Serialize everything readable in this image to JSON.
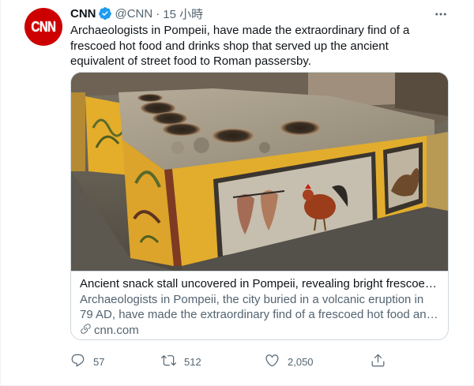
{
  "tweet": {
    "author_name": "CNN",
    "avatar_text": "CNN",
    "handle": "@CNN",
    "separator": "·",
    "time": "15 小時",
    "text": "Archaeologists in Pompeii, have made the extraordinary find of a frescoed hot food and drinks shop that served up the ancient equivalent of street food to Roman passersby."
  },
  "card": {
    "title": "Ancient snack stall uncovered in Pompeii, revealing bright frescoes and ...",
    "description": "Archaeologists in Pompeii, the city buried in a volcanic eruption in 79 AD, have made the extraordinary find of a frescoed hot food and drinks sho...",
    "domain": "cnn.com"
  },
  "actions": {
    "replies": "57",
    "retweets": "512",
    "likes": "2,050"
  },
  "colors": {
    "brand_red": "#cc0000",
    "verified_blue": "#1d9bf0",
    "secondary_text": "#536471",
    "fresco_yellow": "#e8b531"
  },
  "icons": {
    "verified": "verified-badge-icon",
    "more": "more-dots-icon",
    "link": "link-icon",
    "reply": "reply-icon",
    "retweet": "retweet-icon",
    "like": "heart-icon",
    "share": "share-icon"
  }
}
